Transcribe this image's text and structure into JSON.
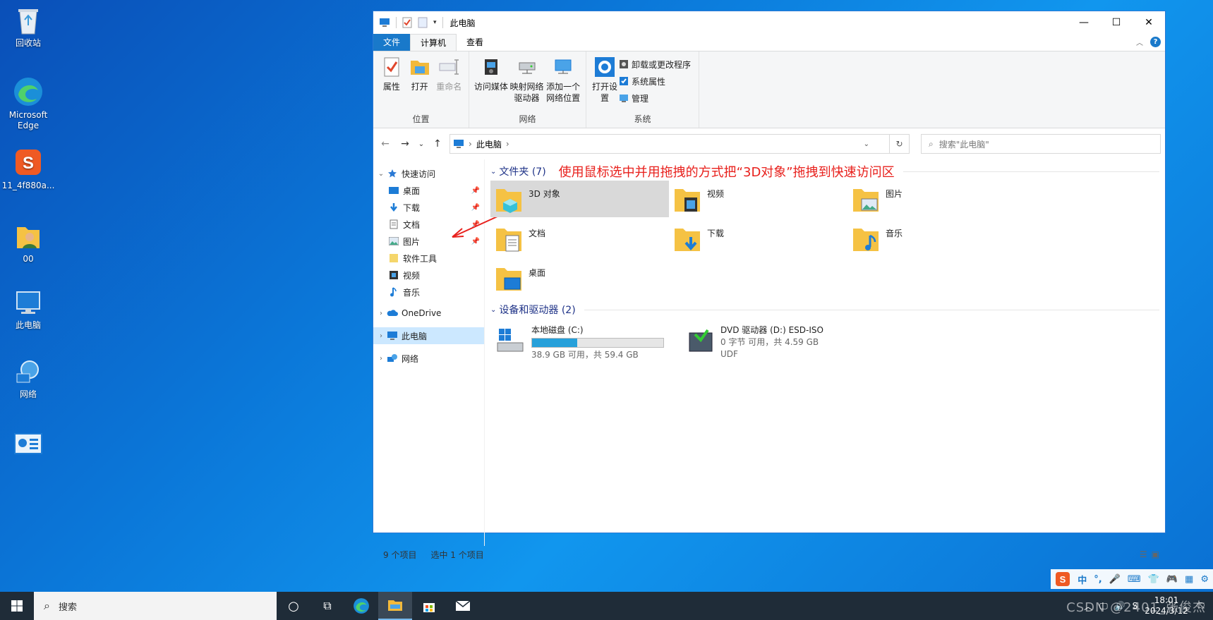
{
  "desktop": {
    "icons": [
      {
        "label": "回收站",
        "icon": "recycle-bin-icon"
      },
      {
        "label": "Microsoft Edge",
        "icon": "edge-icon"
      },
      {
        "label": "11_4f880a...",
        "icon": "sogou-icon"
      },
      {
        "label": "00",
        "icon": "user-folder-icon"
      },
      {
        "label": "此电脑",
        "icon": "this-pc-icon"
      },
      {
        "label": "网络",
        "icon": "network-icon"
      },
      {
        "label": "",
        "icon": "control-panel-icon"
      }
    ]
  },
  "window": {
    "title": "此电脑",
    "tabs": [
      "文件",
      "计算机",
      "查看"
    ],
    "active_tab": "计算机",
    "ribbon": {
      "groups": [
        {
          "label": "位置",
          "buttons": [
            "属性",
            "打开",
            "重命名"
          ]
        },
        {
          "label": "网络",
          "buttons": [
            "访问媒体",
            "映射网络驱动器",
            "添加一个网络位置"
          ]
        },
        {
          "label": "系统",
          "buttons": [
            "打开设置"
          ],
          "small": [
            "卸载或更改程序",
            "系统属性",
            "管理"
          ]
        }
      ]
    },
    "address": {
      "path": "此电脑",
      "search_placeholder": "搜索\"此电脑\""
    },
    "nav_pane": {
      "quick_access_label": "快速访问",
      "quick_items": [
        {
          "label": "桌面",
          "pinned": true
        },
        {
          "label": "下载",
          "pinned": true
        },
        {
          "label": "文档",
          "pinned": true
        },
        {
          "label": "图片",
          "pinned": true
        },
        {
          "label": "软件工具",
          "pinned": false
        },
        {
          "label": "视频",
          "pinned": false
        },
        {
          "label": "音乐",
          "pinned": false
        }
      ],
      "onedrive": "OneDrive",
      "this_pc": "此电脑",
      "network": "网络"
    },
    "content": {
      "folders_header": "文件夹 (7)",
      "annotation": "使用鼠标选中并用拖拽的方式把“3D对象”拖拽到快速访问区",
      "folders": [
        {
          "name": "3D 对象",
          "selected": true
        },
        {
          "name": "视频"
        },
        {
          "name": "图片"
        },
        {
          "name": "文档"
        },
        {
          "name": "下载"
        },
        {
          "name": "音乐"
        },
        {
          "name": "桌面"
        }
      ],
      "devices_header": "设备和驱动器 (2)",
      "drives": [
        {
          "name": "本地磁盘 (C:)",
          "free": "38.9 GB 可用，共 59.4 GB",
          "used_fraction": 0.345
        },
        {
          "name": "DVD 驱动器 (D:) ESD-ISO",
          "free": "0 字节 可用，共 4.59 GB",
          "fs": "UDF"
        }
      ]
    },
    "status": {
      "count": "9 个项目",
      "selected": "选中 1 个项目"
    }
  },
  "taskbar": {
    "search_label": "搜索",
    "time": "18:01",
    "date": "2024/3/12",
    "watermark": "CSDN @2401_张俊杰",
    "ime_label": "中"
  }
}
